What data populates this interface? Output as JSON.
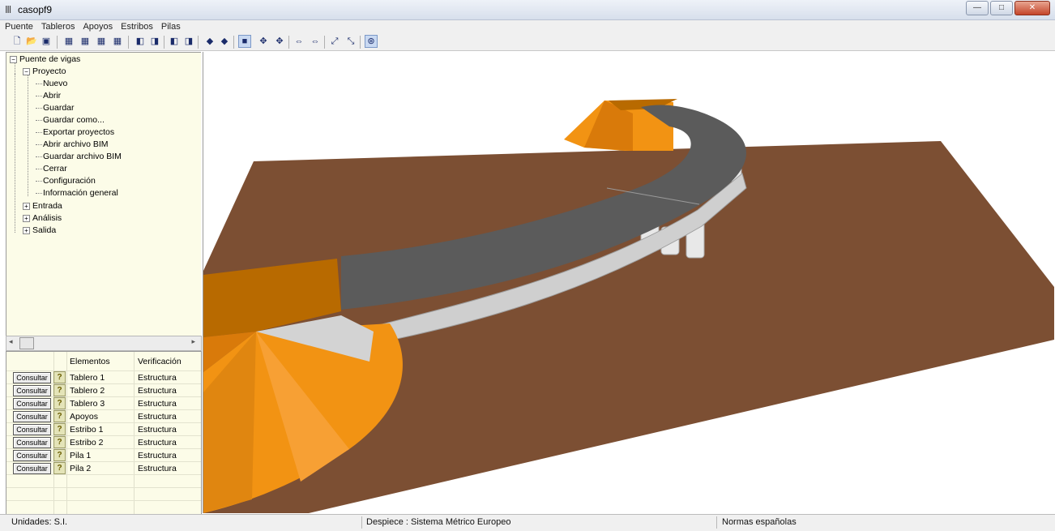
{
  "window": {
    "title": "casopf9",
    "buttons": {
      "minimize": "—",
      "maximize": "□",
      "close": "✕"
    }
  },
  "menu": [
    "Puente",
    "Tableros",
    "Apoyos",
    "Estribos",
    "Pilas"
  ],
  "toolbar": {
    "icons": [
      "new-file-icon",
      "open-folder-icon",
      "save-icon",
      "view-front-icon",
      "view-side-icon",
      "view-top-icon",
      "view-iso-icon",
      "cube-view-1-icon",
      "cube-view-2-icon",
      "cube-view-3-icon",
      "cube-view-4-icon",
      "solid-view-1-icon",
      "solid-view-2-icon",
      "shaded-view-icon",
      "rotate-x-icon",
      "rotate-y-icon",
      "pan-x-icon",
      "pan-y-icon",
      "zoom-in-icon",
      "zoom-out-icon",
      "reset-view-icon"
    ],
    "active": "shaded-view-icon"
  },
  "tree": {
    "root": "Puente de vigas",
    "proyecto": "Proyecto",
    "proyecto_items": [
      "Nuevo",
      "Abrir",
      "Guardar",
      "Guardar como...",
      "Exportar proyectos",
      "Abrir archivo BIM",
      "Guardar archivo BIM",
      "Cerrar",
      "Configuración",
      "Información general"
    ],
    "others": [
      "Entrada",
      "Análisis",
      "Salida"
    ]
  },
  "grid": {
    "headers": {
      "elementos": "Elementos",
      "verificacion": "Verificación"
    },
    "button_label": "Consultar",
    "help_glyph": "?",
    "rows": [
      {
        "elemento": "Tablero 1",
        "verificacion": "Estructura"
      },
      {
        "elemento": "Tablero 2",
        "verificacion": "Estructura"
      },
      {
        "elemento": "Tablero 3",
        "verificacion": "Estructura"
      },
      {
        "elemento": "Apoyos",
        "verificacion": "Estructura"
      },
      {
        "elemento": "Estribo 1",
        "verificacion": "Estructura"
      },
      {
        "elemento": "Estribo 2",
        "verificacion": "Estructura"
      },
      {
        "elemento": "Pila 1",
        "verificacion": "Estructura"
      },
      {
        "elemento": "Pila 2",
        "verificacion": "Estructura"
      }
    ]
  },
  "status": {
    "units": "Unidades: S.I.",
    "despiece": "Despiece :  Sistema Métrico Europeo",
    "normas": "Normas españolas"
  },
  "colors": {
    "terrain": "#7c4f33",
    "deck": "#5b5b5b",
    "embankment": "#f29313",
    "embankment_dark": "#b86a00",
    "beam": "#cfcfcf",
    "tree_bg": "#fcfce8"
  }
}
